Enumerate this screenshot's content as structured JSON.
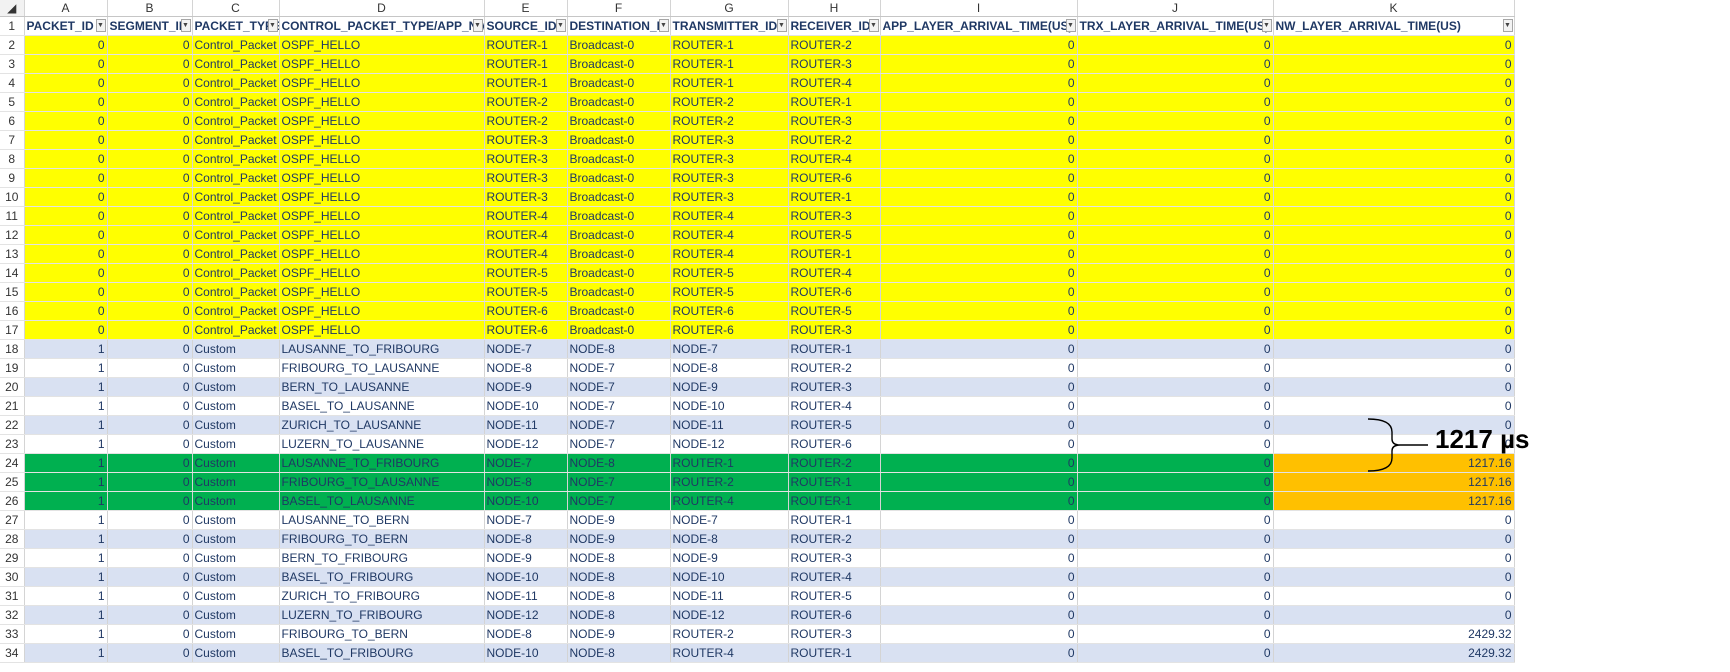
{
  "columns": [
    "A",
    "B",
    "C",
    "D",
    "E",
    "F",
    "G",
    "H",
    "I",
    "J",
    "K"
  ],
  "headers": [
    "PACKET_ID",
    "SEGMENT_ID",
    "PACKET_TYPE",
    "CONTROL_PACKET_TYPE/APP_NAME",
    "SOURCE_ID",
    "DESTINATION_ID",
    "TRANSMITTER_ID",
    "RECEIVER_ID",
    "APP_LAYER_ARRIVAL_TIME(US)",
    "TRX_LAYER_ARRIVAL_TIME(US)",
    "NW_LAYER_ARRIVAL_TIME(US)"
  ],
  "colors": {
    "yellow": "#ffff00",
    "band": "#d9e1f2",
    "green": "#00b050",
    "orange": "#ffc000",
    "text": "#1f3864"
  },
  "rows": [
    {
      "n": "2",
      "style": "yellow",
      "cells": [
        "0",
        "0",
        "Control_Packet",
        "OSPF_HELLO",
        "ROUTER-1",
        "Broadcast-0",
        "ROUTER-1",
        "ROUTER-2",
        "0",
        "0",
        "0"
      ]
    },
    {
      "n": "3",
      "style": "yellow",
      "cells": [
        "0",
        "0",
        "Control_Packet",
        "OSPF_HELLO",
        "ROUTER-1",
        "Broadcast-0",
        "ROUTER-1",
        "ROUTER-3",
        "0",
        "0",
        "0"
      ]
    },
    {
      "n": "4",
      "style": "yellow",
      "cells": [
        "0",
        "0",
        "Control_Packet",
        "OSPF_HELLO",
        "ROUTER-1",
        "Broadcast-0",
        "ROUTER-1",
        "ROUTER-4",
        "0",
        "0",
        "0"
      ]
    },
    {
      "n": "5",
      "style": "yellow",
      "cells": [
        "0",
        "0",
        "Control_Packet",
        "OSPF_HELLO",
        "ROUTER-2",
        "Broadcast-0",
        "ROUTER-2",
        "ROUTER-1",
        "0",
        "0",
        "0"
      ]
    },
    {
      "n": "6",
      "style": "yellow",
      "cells": [
        "0",
        "0",
        "Control_Packet",
        "OSPF_HELLO",
        "ROUTER-2",
        "Broadcast-0",
        "ROUTER-2",
        "ROUTER-3",
        "0",
        "0",
        "0"
      ]
    },
    {
      "n": "7",
      "style": "yellow",
      "cells": [
        "0",
        "0",
        "Control_Packet",
        "OSPF_HELLO",
        "ROUTER-3",
        "Broadcast-0",
        "ROUTER-3",
        "ROUTER-2",
        "0",
        "0",
        "0"
      ]
    },
    {
      "n": "8",
      "style": "yellow",
      "cells": [
        "0",
        "0",
        "Control_Packet",
        "OSPF_HELLO",
        "ROUTER-3",
        "Broadcast-0",
        "ROUTER-3",
        "ROUTER-4",
        "0",
        "0",
        "0"
      ]
    },
    {
      "n": "9",
      "style": "yellow",
      "cells": [
        "0",
        "0",
        "Control_Packet",
        "OSPF_HELLO",
        "ROUTER-3",
        "Broadcast-0",
        "ROUTER-3",
        "ROUTER-6",
        "0",
        "0",
        "0"
      ]
    },
    {
      "n": "10",
      "style": "yellow",
      "cells": [
        "0",
        "0",
        "Control_Packet",
        "OSPF_HELLO",
        "ROUTER-3",
        "Broadcast-0",
        "ROUTER-3",
        "ROUTER-1",
        "0",
        "0",
        "0"
      ]
    },
    {
      "n": "11",
      "style": "yellow",
      "cells": [
        "0",
        "0",
        "Control_Packet",
        "OSPF_HELLO",
        "ROUTER-4",
        "Broadcast-0",
        "ROUTER-4",
        "ROUTER-3",
        "0",
        "0",
        "0"
      ]
    },
    {
      "n": "12",
      "style": "yellow",
      "cells": [
        "0",
        "0",
        "Control_Packet",
        "OSPF_HELLO",
        "ROUTER-4",
        "Broadcast-0",
        "ROUTER-4",
        "ROUTER-5",
        "0",
        "0",
        "0"
      ]
    },
    {
      "n": "13",
      "style": "yellow",
      "cells": [
        "0",
        "0",
        "Control_Packet",
        "OSPF_HELLO",
        "ROUTER-4",
        "Broadcast-0",
        "ROUTER-4",
        "ROUTER-1",
        "0",
        "0",
        "0"
      ]
    },
    {
      "n": "14",
      "style": "yellow",
      "cells": [
        "0",
        "0",
        "Control_Packet",
        "OSPF_HELLO",
        "ROUTER-5",
        "Broadcast-0",
        "ROUTER-5",
        "ROUTER-4",
        "0",
        "0",
        "0"
      ]
    },
    {
      "n": "15",
      "style": "yellow",
      "cells": [
        "0",
        "0",
        "Control_Packet",
        "OSPF_HELLO",
        "ROUTER-5",
        "Broadcast-0",
        "ROUTER-5",
        "ROUTER-6",
        "0",
        "0",
        "0"
      ]
    },
    {
      "n": "16",
      "style": "yellow",
      "cells": [
        "0",
        "0",
        "Control_Packet",
        "OSPF_HELLO",
        "ROUTER-6",
        "Broadcast-0",
        "ROUTER-6",
        "ROUTER-5",
        "0",
        "0",
        "0"
      ]
    },
    {
      "n": "17",
      "style": "yellow",
      "cells": [
        "0",
        "0",
        "Control_Packet",
        "OSPF_HELLO",
        "ROUTER-6",
        "Broadcast-0",
        "ROUTER-6",
        "ROUTER-3",
        "0",
        "0",
        "0"
      ]
    },
    {
      "n": "18",
      "style": "band",
      "cells": [
        "1",
        "0",
        "Custom",
        "LAUSANNE_TO_FRIBOURG",
        "NODE-7",
        "NODE-8",
        "NODE-7",
        "ROUTER-1",
        "0",
        "0",
        "0"
      ]
    },
    {
      "n": "19",
      "style": "plain",
      "cells": [
        "1",
        "0",
        "Custom",
        "FRIBOURG_TO_LAUSANNE",
        "NODE-8",
        "NODE-7",
        "NODE-8",
        "ROUTER-2",
        "0",
        "0",
        "0"
      ]
    },
    {
      "n": "20",
      "style": "band",
      "cells": [
        "1",
        "0",
        "Custom",
        "BERN_TO_LAUSANNE",
        "NODE-9",
        "NODE-7",
        "NODE-9",
        "ROUTER-3",
        "0",
        "0",
        "0"
      ]
    },
    {
      "n": "21",
      "style": "plain",
      "cells": [
        "1",
        "0",
        "Custom",
        "BASEL_TO_LAUSANNE",
        "NODE-10",
        "NODE-7",
        "NODE-10",
        "ROUTER-4",
        "0",
        "0",
        "0"
      ]
    },
    {
      "n": "22",
      "style": "band",
      "cells": [
        "1",
        "0",
        "Custom",
        "ZURICH_TO_LAUSANNE",
        "NODE-11",
        "NODE-7",
        "NODE-11",
        "ROUTER-5",
        "0",
        "0",
        "0"
      ]
    },
    {
      "n": "23",
      "style": "plain",
      "cells": [
        "1",
        "0",
        "Custom",
        "LUZERN_TO_LAUSANNE",
        "NODE-12",
        "NODE-7",
        "NODE-12",
        "ROUTER-6",
        "0",
        "0",
        "0"
      ]
    },
    {
      "n": "24",
      "style": "green",
      "highlightK": true,
      "cells": [
        "1",
        "0",
        "Custom",
        "LAUSANNE_TO_FRIBOURG",
        "NODE-7",
        "NODE-8",
        "ROUTER-1",
        "ROUTER-2",
        "0",
        "0",
        "1217.16"
      ]
    },
    {
      "n": "25",
      "style": "green",
      "highlightK": true,
      "cells": [
        "1",
        "0",
        "Custom",
        "FRIBOURG_TO_LAUSANNE",
        "NODE-8",
        "NODE-7",
        "ROUTER-2",
        "ROUTER-1",
        "0",
        "0",
        "1217.16"
      ]
    },
    {
      "n": "26",
      "style": "green",
      "highlightK": true,
      "cells": [
        "1",
        "0",
        "Custom",
        "BASEL_TO_LAUSANNE",
        "NODE-10",
        "NODE-7",
        "ROUTER-4",
        "ROUTER-1",
        "0",
        "0",
        "1217.16"
      ]
    },
    {
      "n": "27",
      "style": "plain",
      "cells": [
        "1",
        "0",
        "Custom",
        "LAUSANNE_TO_BERN",
        "NODE-7",
        "NODE-9",
        "NODE-7",
        "ROUTER-1",
        "0",
        "0",
        "0"
      ]
    },
    {
      "n": "28",
      "style": "band",
      "cells": [
        "1",
        "0",
        "Custom",
        "FRIBOURG_TO_BERN",
        "NODE-8",
        "NODE-9",
        "NODE-8",
        "ROUTER-2",
        "0",
        "0",
        "0"
      ]
    },
    {
      "n": "29",
      "style": "plain",
      "cells": [
        "1",
        "0",
        "Custom",
        "BERN_TO_FRIBOURG",
        "NODE-9",
        "NODE-8",
        "NODE-9",
        "ROUTER-3",
        "0",
        "0",
        "0"
      ]
    },
    {
      "n": "30",
      "style": "band",
      "cells": [
        "1",
        "0",
        "Custom",
        "BASEL_TO_FRIBOURG",
        "NODE-10",
        "NODE-8",
        "NODE-10",
        "ROUTER-4",
        "0",
        "0",
        "0"
      ]
    },
    {
      "n": "31",
      "style": "plain",
      "cells": [
        "1",
        "0",
        "Custom",
        "ZURICH_TO_FRIBOURG",
        "NODE-11",
        "NODE-8",
        "NODE-11",
        "ROUTER-5",
        "0",
        "0",
        "0"
      ]
    },
    {
      "n": "32",
      "style": "band",
      "cells": [
        "1",
        "0",
        "Custom",
        "LUZERN_TO_FRIBOURG",
        "NODE-12",
        "NODE-8",
        "NODE-12",
        "ROUTER-6",
        "0",
        "0",
        "0"
      ]
    },
    {
      "n": "33",
      "style": "plain",
      "cells": [
        "1",
        "0",
        "Custom",
        "FRIBOURG_TO_BERN",
        "NODE-8",
        "NODE-9",
        "ROUTER-2",
        "ROUTER-3",
        "0",
        "0",
        "2429.32"
      ]
    },
    {
      "n": "34",
      "style": "band",
      "cells": [
        "1",
        "0",
        "Custom",
        "BASEL_TO_FRIBOURG",
        "NODE-10",
        "NODE-8",
        "ROUTER-4",
        "ROUTER-1",
        "0",
        "0",
        "2429.32"
      ]
    }
  ],
  "annotation": {
    "label": "1217 µs"
  }
}
